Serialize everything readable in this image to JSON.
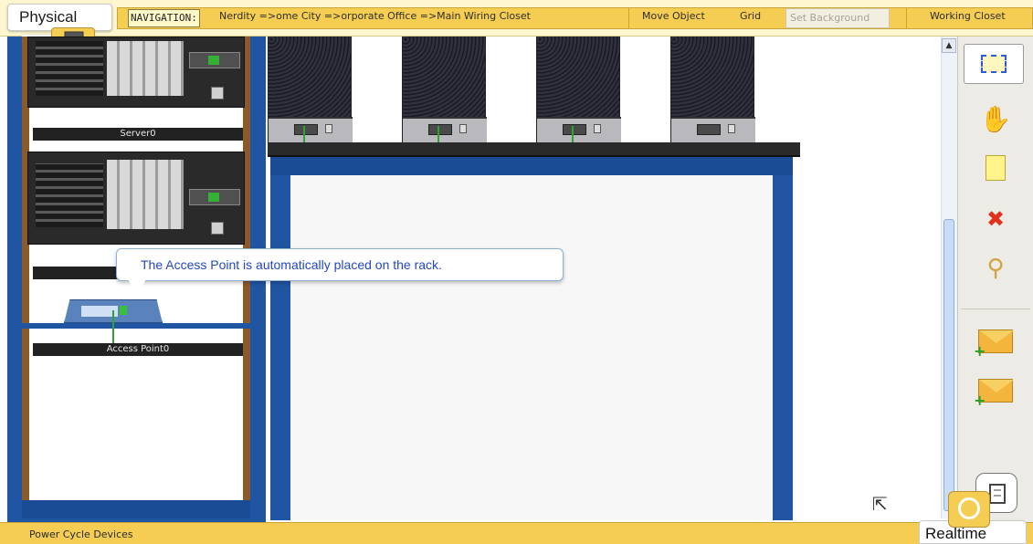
{
  "header": {
    "mode_tab": "Physical",
    "navigation_label": "NAVIGATION:",
    "navigation_path": "Nerdity =>ome City =>orporate Office =>Main Wiring Closet",
    "move_object": "Move Object",
    "grid": "Grid",
    "set_background": "Set Background",
    "current_location": "Working Closet"
  },
  "rack": {
    "devices": [
      {
        "name": "Server0"
      },
      {
        "name": "Access Point0"
      }
    ]
  },
  "tooltip": {
    "text": "The Access Point is automatically placed on the rack."
  },
  "toolbar": {
    "tools": [
      "select",
      "move-layout",
      "place-note",
      "delete",
      "inspect",
      "add-simple-pdu",
      "add-complex-pdu"
    ]
  },
  "footer": {
    "power_cycle": "Power Cycle Devices",
    "time_mode": "Realtime"
  },
  "colors": {
    "accent_yellow": "#f5cd52",
    "rack_blue": "#1f55a2",
    "tooltip_text": "#2347c4"
  }
}
